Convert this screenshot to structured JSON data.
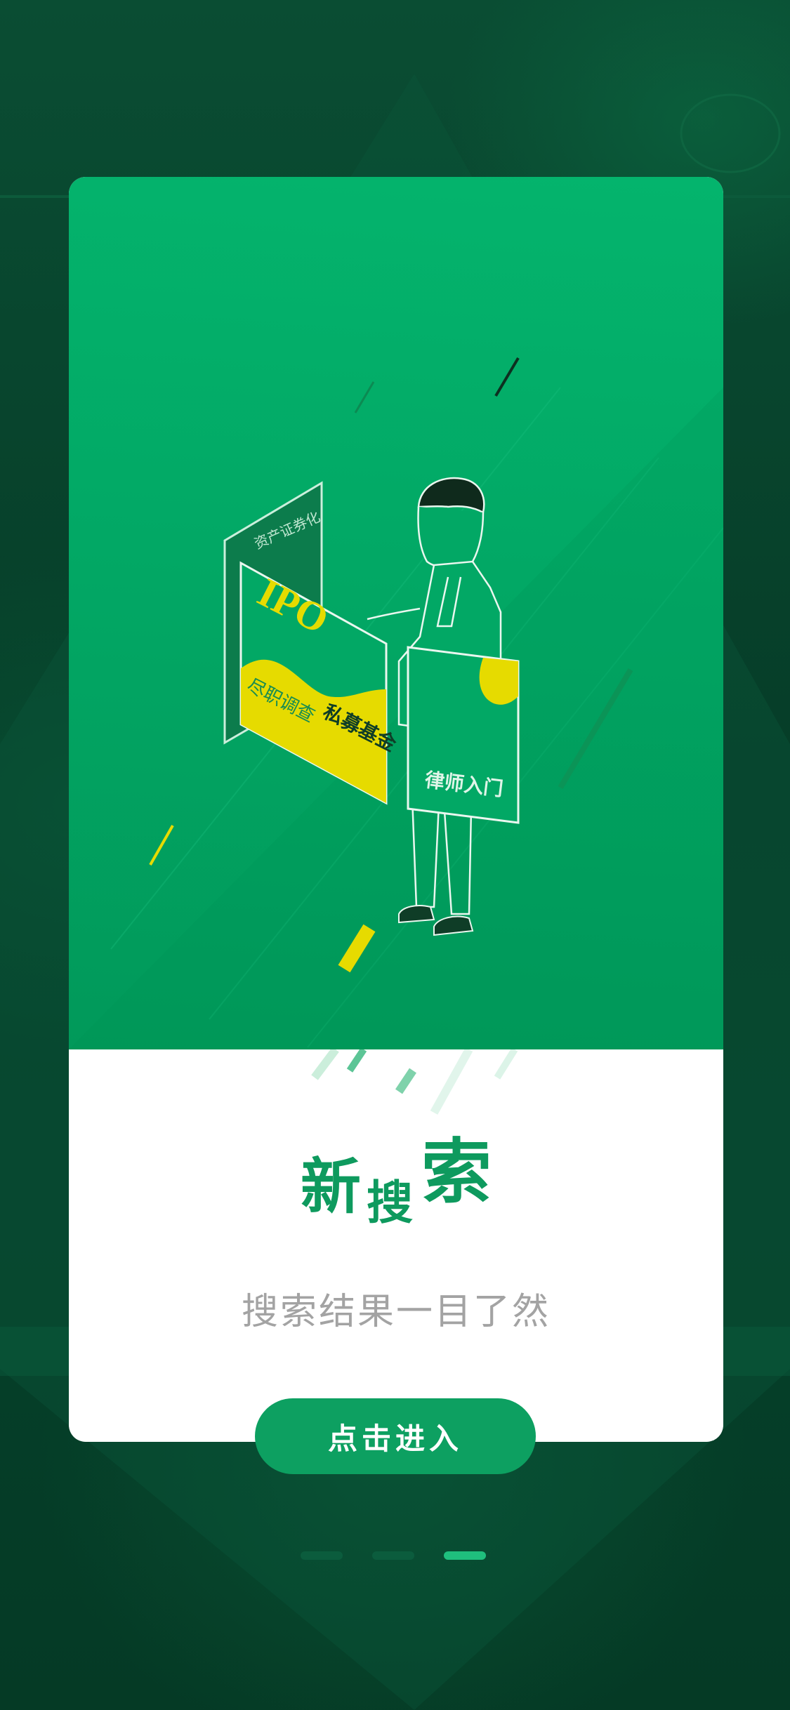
{
  "hero": {
    "card_labels": {
      "ipo": "IPO",
      "asset_securitization": "资产证券化",
      "due_diligence": "尽职调查",
      "private_fund": "私募基金",
      "lawyer_intro": "律师入门"
    }
  },
  "title": {
    "char1": "新",
    "char2": "搜",
    "char3": "索"
  },
  "subtitle": "搜索结果一目了然",
  "enter_button": {
    "label": "点击进入"
  },
  "pager": {
    "total": 3,
    "active_index": 3
  },
  "colors": {
    "accent": "#0da061",
    "title": "#0e9a5e",
    "hero_top": "#04b46d",
    "hero_bottom": "#01995a",
    "card_yellow": "#e6db00",
    "background": "#063f2a"
  }
}
